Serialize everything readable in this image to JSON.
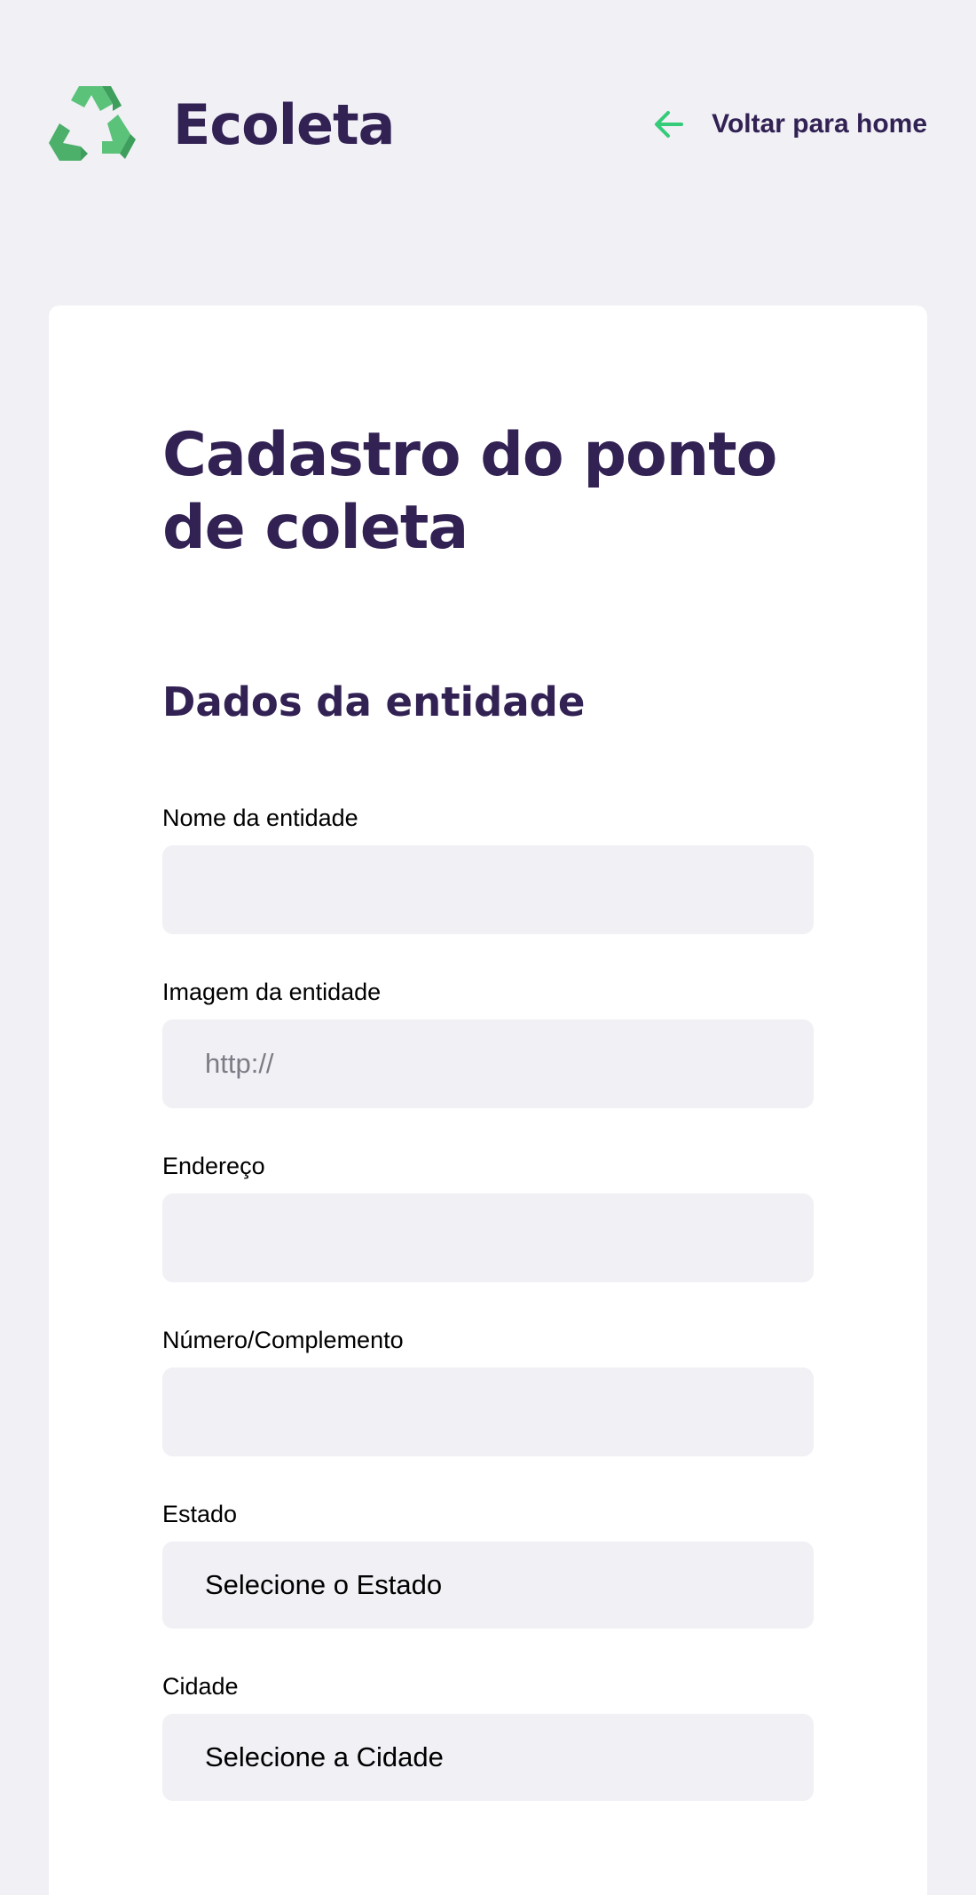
{
  "header": {
    "brand_name": "Ecoleta",
    "logo_icon": "recycle-icon",
    "back_link_label": "Voltar para home",
    "back_icon": "arrow-left-icon"
  },
  "form": {
    "title": "Cadastro do ponto de coleta",
    "section_title": "Dados da entidade",
    "fields": {
      "name": {
        "label": "Nome da entidade",
        "value": "",
        "placeholder": ""
      },
      "image": {
        "label": "Imagem da entidade",
        "value": "",
        "placeholder": "http://"
      },
      "address": {
        "label": "Endereço",
        "value": "",
        "placeholder": ""
      },
      "number": {
        "label": "Número/Complemento",
        "value": "",
        "placeholder": ""
      },
      "state": {
        "label": "Estado",
        "selected": "Selecione o Estado"
      },
      "city": {
        "label": "Cidade",
        "selected": "Selecione a Cidade"
      }
    }
  },
  "colors": {
    "background": "#F0F0F5",
    "primary_text": "#322153",
    "accent_green": "#34CB79",
    "card": "#FFFFFF",
    "input_bg": "#F0F0F5"
  }
}
